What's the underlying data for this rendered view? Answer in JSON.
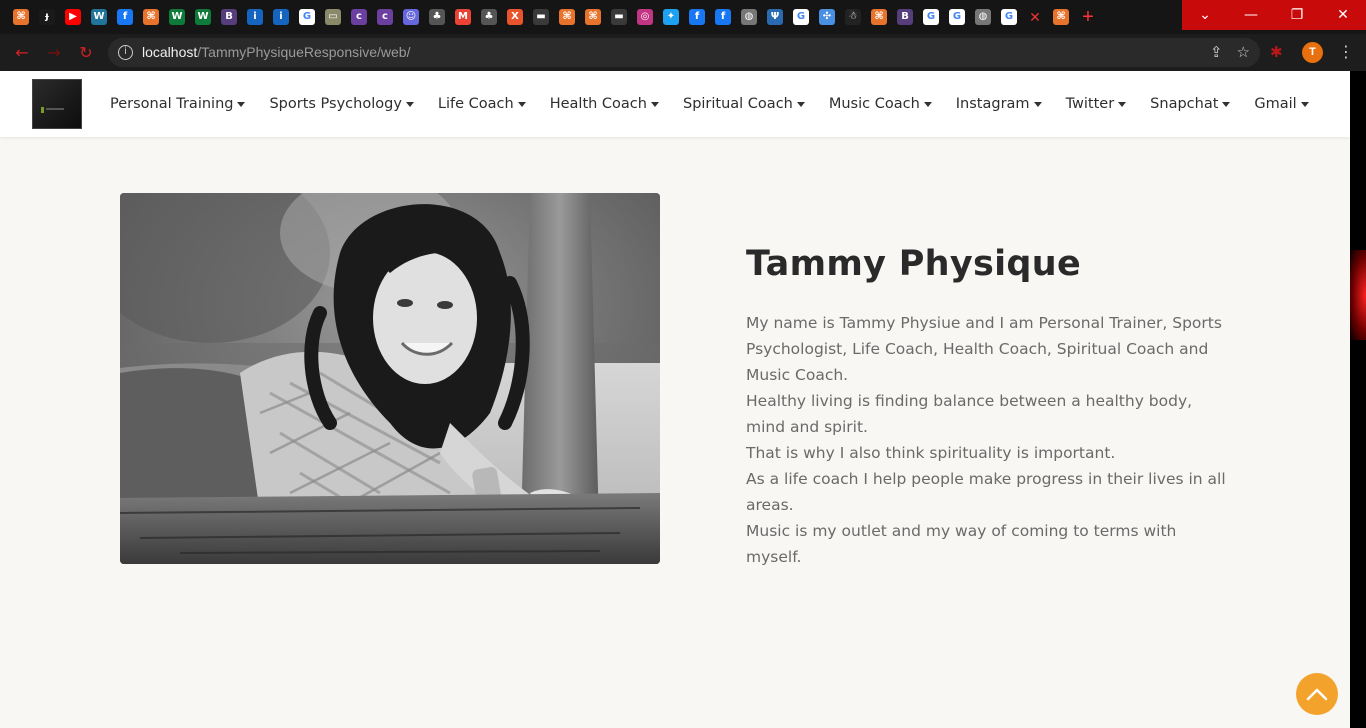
{
  "browser": {
    "url_host": "localhost",
    "url_path": "/TammyPhysiqueResponsive/web/",
    "profile_initial": "T",
    "tab_icons": [
      {
        "name": "xampp-icon",
        "color": "#e8732c",
        "glyph": "⌘"
      },
      {
        "name": "green-logo-icon",
        "color": "#1a1a1a",
        "glyph": "ɟ"
      },
      {
        "name": "youtube-icon",
        "color": "#ff0000",
        "glyph": "▶"
      },
      {
        "name": "wordpress-icon",
        "color": "#21759b",
        "glyph": "W"
      },
      {
        "name": "facebook-icon",
        "color": "#1877f2",
        "glyph": "f"
      },
      {
        "name": "xampp-icon",
        "color": "#e8732c",
        "glyph": "⌘"
      },
      {
        "name": "webflow-icon",
        "color": "#0f7b3a",
        "glyph": "W"
      },
      {
        "name": "webflow-icon",
        "color": "#0f7b3a",
        "glyph": "W"
      },
      {
        "name": "bootstrap-icon",
        "color": "#563d7c",
        "glyph": "B"
      },
      {
        "name": "info-icon",
        "color": "#1565c0",
        "glyph": "i"
      },
      {
        "name": "info-icon",
        "color": "#1565c0",
        "glyph": "i"
      },
      {
        "name": "google-icon",
        "color": "#ffffff",
        "glyph": "G"
      },
      {
        "name": "image-icon",
        "color": "#8a8a6a",
        "glyph": "▭"
      },
      {
        "name": "colorlib-icon",
        "color": "#6a3fa0",
        "glyph": "c"
      },
      {
        "name": "colorlib-icon",
        "color": "#6a3fa0",
        "glyph": "c"
      },
      {
        "name": "pocket-icon",
        "color": "#6666dd",
        "glyph": "☺"
      },
      {
        "name": "bird-icon",
        "color": "#555555",
        "glyph": "♣"
      },
      {
        "name": "gmail-icon",
        "color": "#ea4335",
        "glyph": "M"
      },
      {
        "name": "bird-icon",
        "color": "#555555",
        "glyph": "♣"
      },
      {
        "name": "xt-icon",
        "color": "#e8552c",
        "glyph": "X"
      },
      {
        "name": "dark-tab-icon",
        "color": "#3a3a3a",
        "glyph": "▬"
      },
      {
        "name": "xampp-icon",
        "color": "#e8732c",
        "glyph": "⌘"
      },
      {
        "name": "xampp-icon",
        "color": "#e8732c",
        "glyph": "⌘"
      },
      {
        "name": "dark-tab-icon",
        "color": "#3a3a3a",
        "glyph": "▬"
      },
      {
        "name": "instagram-icon",
        "color": "#c13584",
        "glyph": "◎"
      },
      {
        "name": "twitter-icon",
        "color": "#1da1f2",
        "glyph": "✦"
      },
      {
        "name": "facebook-icon",
        "color": "#1877f2",
        "glyph": "f"
      },
      {
        "name": "facebook-icon",
        "color": "#1877f2",
        "glyph": "f"
      },
      {
        "name": "globe-icon",
        "color": "#777777",
        "glyph": "◍"
      },
      {
        "name": "trident-icon",
        "color": "#2a6ab0",
        "glyph": "Ψ"
      },
      {
        "name": "google-icon",
        "color": "#ffffff",
        "glyph": "G"
      },
      {
        "name": "dots-icon",
        "color": "#4a90e2",
        "glyph": "✣"
      },
      {
        "name": "snapchat-icon",
        "color": "#222222",
        "glyph": "☃"
      },
      {
        "name": "xampp-icon",
        "color": "#e8732c",
        "glyph": "⌘"
      },
      {
        "name": "bootstrap-icon",
        "color": "#563d7c",
        "glyph": "B"
      },
      {
        "name": "google-icon",
        "color": "#ffffff",
        "glyph": "G"
      },
      {
        "name": "google-icon",
        "color": "#ffffff",
        "glyph": "G"
      },
      {
        "name": "globe-icon",
        "color": "#777777",
        "glyph": "◍"
      },
      {
        "name": "google-icon",
        "color": "#ffffff",
        "glyph": "G"
      }
    ],
    "active_tab_icon": {
      "name": "xampp-icon",
      "color": "#e8732c",
      "glyph": "⌘"
    }
  },
  "nav": {
    "items": [
      {
        "label": "Personal Training"
      },
      {
        "label": "Sports Psychology"
      },
      {
        "label": "Life Coach"
      },
      {
        "label": "Health Coach"
      },
      {
        "label": "Spiritual Coach"
      },
      {
        "label": "Music Coach"
      },
      {
        "label": "Instagram"
      },
      {
        "label": "Twitter"
      },
      {
        "label": "Snapchat"
      },
      {
        "label": "Gmail"
      }
    ]
  },
  "profile": {
    "name": "Tammy Physique",
    "bio": [
      "My name is Tammy Physiue and I am Personal Trainer, Sports Psychologist, Life Coach, Health Coach, Spiritual Coach and Music Coach.",
      "Healthy living is finding balance between a healthy body, mind and spirit.",
      "That is why I also think spirituality is important.",
      "As a life coach I help people make progress in their lives in all areas.",
      "Music is my outlet and my way of coming to terms with myself."
    ]
  },
  "colors": {
    "accent": "#f3a32c",
    "page_bg": "#f8f7f4",
    "window_controls": "#c90a0a"
  }
}
